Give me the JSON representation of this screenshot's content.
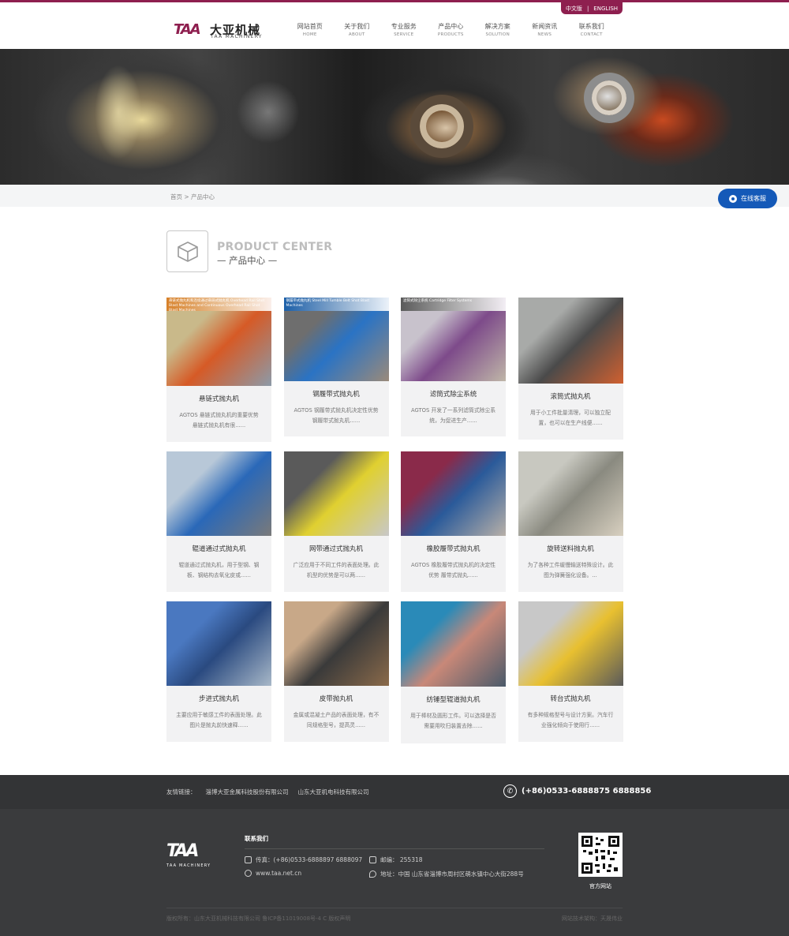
{
  "lang": {
    "cn": "中文版",
    "sep": "|",
    "en": "ENGLISH"
  },
  "logo": {
    "mark": "TAA",
    "cn": "大亚机械",
    "en": "TAA MACHINERY"
  },
  "nav": [
    {
      "cn": "网站首页",
      "en": "HOME"
    },
    {
      "cn": "关于我们",
      "en": "ABOUT"
    },
    {
      "cn": "专业服务",
      "en": "SERVICE"
    },
    {
      "cn": "产品中心",
      "en": "PRODUCTS"
    },
    {
      "cn": "解决方案",
      "en": "SOLUTION"
    },
    {
      "cn": "新闻资讯",
      "en": "NEWS"
    },
    {
      "cn": "联系我们",
      "en": "CONTACT"
    }
  ],
  "breadcrumb": "首页 > 产品中心",
  "service": "在线客服",
  "section": {
    "title_en": "PRODUCT CENTER",
    "title_cn": "— 产品中心 —"
  },
  "products": [
    {
      "title": "悬链式抛丸机",
      "desc": "AGTOS 悬链式抛丸机的重要优势 悬链式抛丸机有很......",
      "badge": "悬链式抛丸机和连续通过悬链式抛丸机 Overhead Rail Shot Blast Machines and Continuous Overhead Rail Shot Blast Machines",
      "badge_color": "#d7812a",
      "img_colors": [
        "#c9b98a",
        "#d65a26",
        "#8c9aa8"
      ]
    },
    {
      "title": "钢履带式抛丸机",
      "desc": "AGTOS 钢履带式抛丸机决定性优势 钢履带式抛丸机......",
      "badge": "钢履带式抛丸机 Steel Mill Tumble Belt Shot Blast Machines",
      "badge_color": "#1c5fa8",
      "img_colors": [
        "#6e6e6e",
        "#2a73c4",
        "#9a8a7a"
      ]
    },
    {
      "title": "滤筒式除尘系统",
      "desc": "AGTOS 开发了一系列滤筒式除尘系统，为促进生产......",
      "badge": "滤筒式除尘系统 Cartridge Filter Systems",
      "badge_color": "#5a5a5a",
      "img_colors": [
        "#c8c2cc",
        "#7d4a8a",
        "#bfb6a8"
      ]
    },
    {
      "title": "滚筒式抛丸机",
      "desc": "用于小工件批量清理，可以独立配置，也可以在生产线便......",
      "badge": "",
      "badge_color": "",
      "img_colors": [
        "#a8aaa8",
        "#4a4a4a",
        "#d06030"
      ]
    },
    {
      "title": "辊道通过式抛丸机",
      "desc": "辊道通过式抛丸机，用于型钢、钢板、钢结构去氧化皮或......",
      "badge": "",
      "badge_color": "",
      "img_colors": [
        "#b8c8d8",
        "#2a68b8",
        "#7a7a7a"
      ]
    },
    {
      "title": "网带通过式抛丸机",
      "desc": "广泛应用于不同工件的表面处理。此机型的优势是可以两......",
      "badge": "",
      "badge_color": "",
      "img_colors": [
        "#5a5a5a",
        "#e0d030",
        "#c8c8c8"
      ]
    },
    {
      "title": "橡胶履带式抛丸机",
      "desc": "AGTOS 橡胶履带式抛丸机的决定性优势 履带式抛丸......",
      "badge": "",
      "badge_color": "",
      "img_colors": [
        "#8a2a4a",
        "#2a5a9a",
        "#b8b0a8"
      ]
    },
    {
      "title": "旋转送料抛丸机",
      "desc": "为了各种工件缓慢输送特殊设计。此图为弹簧强化设备。...",
      "badge": "",
      "badge_color": "",
      "img_colors": [
        "#c8c8c0",
        "#8a8a80",
        "#d8d0c0"
      ]
    },
    {
      "title": "步进式抛丸机",
      "desc": "主要应用于敏感工件的表面处理。此图片是抛丸前快速释......",
      "badge": "",
      "badge_color": "",
      "img_colors": [
        "#4a78c0",
        "#2a4a80",
        "#a8b8c8"
      ]
    },
    {
      "title": "皮带抛丸机",
      "desc": "金属或混凝土产品的表面处理，有不同规格型号，提高灵......",
      "badge": "",
      "badge_color": "",
      "img_colors": [
        "#c8a888",
        "#3a3a3a",
        "#8a6a4a"
      ]
    },
    {
      "title": "纺锤型辊道抛丸机",
      "desc": "用于棒材及圆形工件。可以选择是否需要用吹扫装置去除......",
      "badge": "",
      "badge_color": "",
      "img_colors": [
        "#2a8ab8",
        "#c88878",
        "#4a5a6a"
      ]
    },
    {
      "title": "转台式抛丸机",
      "desc": "有多种规格型号与设计方案。汽车行业强化倾向于使用行......",
      "badge": "",
      "badge_color": "",
      "img_colors": [
        "#c8c8c8",
        "#e8c030",
        "#5a5a5a"
      ]
    }
  ],
  "footer": {
    "links_label": "友情链接：",
    "links": [
      "淄博大亚金属科技股份有限公司",
      "山东大亚机电科技有限公司"
    ],
    "phone": "(+86)0533-6888875 6888856",
    "logo_mark": "TAA",
    "logo_en": "TAA MACHINERY",
    "contact_head": "联系我们",
    "fax": "传真：(+86)0533-6888897 6888097",
    "zip": "邮编：  255318",
    "web": "www.taa.net.cn",
    "address": "地址：中国 山东省淄博市周村区萌水镇中心大街288号",
    "qr_label": "官方网站",
    "copyright": "版权所有：山东大亚机械科技有限公司 鲁ICP备11019008号-4 C 版权声明",
    "tech": "网站技术架构：天晟伟业"
  }
}
